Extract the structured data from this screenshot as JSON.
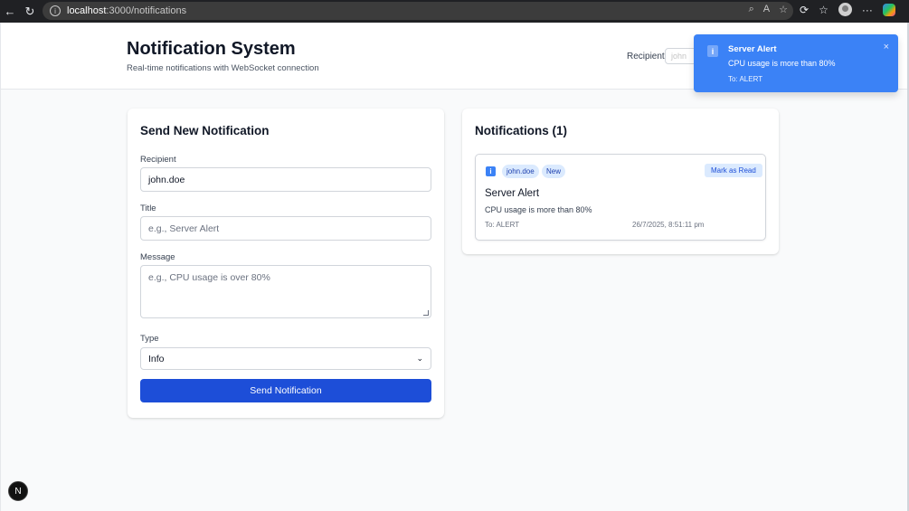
{
  "browser": {
    "url_host": "localhost",
    "url_path": ":3000/notifications"
  },
  "header": {
    "title": "Notification System",
    "subtitle": "Real-time notifications with WebSocket connection",
    "recipient_label": "Recipient:",
    "recipient_value": "john"
  },
  "form": {
    "heading": "Send New Notification",
    "recipient_label": "Recipient",
    "recipient_value": "john.doe",
    "title_label": "Title",
    "title_placeholder": "e.g., Server Alert",
    "message_label": "Message",
    "message_placeholder": "e.g., CPU usage is over 80%",
    "type_label": "Type",
    "type_value": "Info",
    "submit_label": "Send Notification"
  },
  "notifications": {
    "heading": "Notifications (1)",
    "items": [
      {
        "recipient": "john.doe",
        "badge": "New",
        "mark_read_label": "Mark as Read",
        "title": "Server Alert",
        "message": "CPU usage is more than 80%",
        "to": "To: ALERT",
        "timestamp": "26/7/2025, 8:51:11 pm"
      }
    ]
  },
  "toast": {
    "title": "Server Alert",
    "message": "CPU usage is more than 80%",
    "to": "To: ALERT",
    "close": "×"
  },
  "dev_badge": "N",
  "colors": {
    "primary": "#1d4ed8",
    "toast_bg": "#3b82f6",
    "badge_bg": "#dbeafe"
  }
}
